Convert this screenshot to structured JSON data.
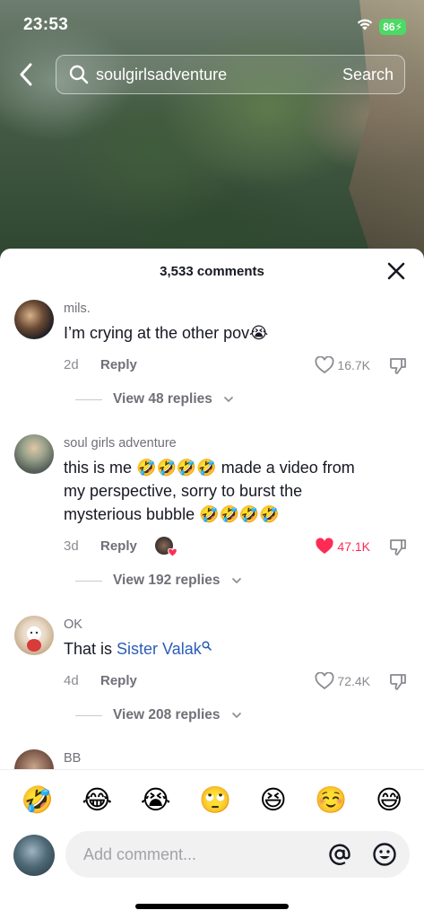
{
  "status": {
    "time": "23:53",
    "battery": "86"
  },
  "search": {
    "query": "soulgirlsadventure",
    "button": "Search"
  },
  "comments_header": {
    "count_label": "3,533 comments"
  },
  "comments": [
    {
      "user": "mils.",
      "text_before": "I’m crying at the other pov",
      "text_emoji": "😭",
      "date": "2d",
      "reply": "Reply",
      "likes": "16.7K",
      "liked": false,
      "replies": "View 48 replies"
    },
    {
      "user": "soul girls adventure",
      "text_line1_before": "this is me ",
      "text_line1_emojis": "🤣🤣🤣🤣",
      "text_line1_after": " made a video from",
      "text_line2": "my perspective, sorry to burst the",
      "text_line3_before": "mysterious bubble ",
      "text_line3_emojis": "🤣🤣🤣🤣",
      "date": "3d",
      "reply": "Reply",
      "likes": "47.1K",
      "liked": true,
      "replies": "View 192 replies"
    },
    {
      "user": "OK",
      "text_before": "That is ",
      "text_link": "Sister Valak",
      "date": "4d",
      "reply": "Reply",
      "likes": "72.4K",
      "liked": false,
      "replies": "View 208 replies"
    },
    {
      "user": "BB"
    }
  ],
  "emoji_bar": [
    "🤣",
    "😂",
    "😭",
    "🙄",
    "😆",
    "☺️",
    "😅"
  ],
  "input": {
    "placeholder": "Add comment..."
  },
  "colors": {
    "like_active": "#fe2c55",
    "link": "#2b5db8",
    "text": "#161823",
    "muted": "#8a8b91"
  }
}
